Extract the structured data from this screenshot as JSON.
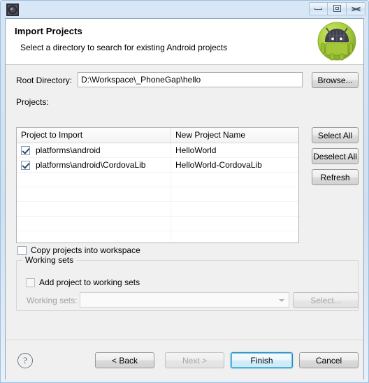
{
  "window": {
    "icon": "eclipse-wizard-icon",
    "controls": [
      {
        "name": "minimize-button",
        "glyph": "minimize-icon"
      },
      {
        "name": "restore-button",
        "glyph": "restore-icon"
      },
      {
        "name": "close-button",
        "glyph": "close-icon"
      }
    ]
  },
  "header": {
    "title": "Import Projects",
    "description": "Select a directory to search for existing Android projects",
    "image": "android-robot-icon",
    "image_colors": {
      "body": "#a4c639",
      "hat": "#3f3f4f"
    }
  },
  "form": {
    "root_directory_label": "Root Directory:",
    "root_directory_value": "D:\\Workspace\\_PhoneGap\\hello",
    "root_directory_placeholder": "",
    "browse_label": "Browse...",
    "projects_label": "Projects:"
  },
  "table": {
    "columns": [
      "Project to Import",
      "New Project Name"
    ],
    "rows": [
      {
        "checked": true,
        "project": "platforms\\android",
        "new_name": "HelloWorld"
      },
      {
        "checked": true,
        "project": "platforms\\android\\CordovaLib",
        "new_name": "HelloWorld-CordovaLib"
      },
      {
        "checked": null,
        "project": "",
        "new_name": ""
      },
      {
        "checked": null,
        "project": "",
        "new_name": ""
      },
      {
        "checked": null,
        "project": "",
        "new_name": ""
      },
      {
        "checked": null,
        "project": "",
        "new_name": ""
      },
      {
        "checked": null,
        "project": "",
        "new_name": ""
      }
    ],
    "side_buttons": [
      {
        "name": "select-all-button",
        "label": "Select All",
        "enabled": true
      },
      {
        "name": "deselect-all-button",
        "label": "Deselect All",
        "enabled": true
      },
      {
        "name": "refresh-button",
        "label": "Refresh",
        "enabled": true
      }
    ]
  },
  "options": {
    "copy_projects_label": "Copy projects into workspace",
    "copy_projects_checked": false
  },
  "working_sets": {
    "group_title": "Working sets",
    "add_project_label": "Add project to working sets",
    "add_project_checked": false,
    "combo_label": "Working sets:",
    "combo_value": "",
    "combo_enabled": false,
    "select_label": "Select...",
    "select_enabled": false
  },
  "footer": {
    "help_icon": "help-icon",
    "buttons": [
      {
        "name": "back-button",
        "label": "< Back",
        "enabled": true,
        "default": false
      },
      {
        "name": "next-button",
        "label": "Next >",
        "enabled": false,
        "default": false
      },
      {
        "name": "finish-button",
        "label": "Finish",
        "enabled": true,
        "default": true
      },
      {
        "name": "cancel-button",
        "label": "Cancel",
        "enabled": true,
        "default": false
      }
    ]
  },
  "colors": {
    "accent": "#3c7fb1",
    "focus_glow": "#5bc6ea",
    "dialog_bg": "#f0f0f0",
    "header_bg": "#ffffff"
  }
}
